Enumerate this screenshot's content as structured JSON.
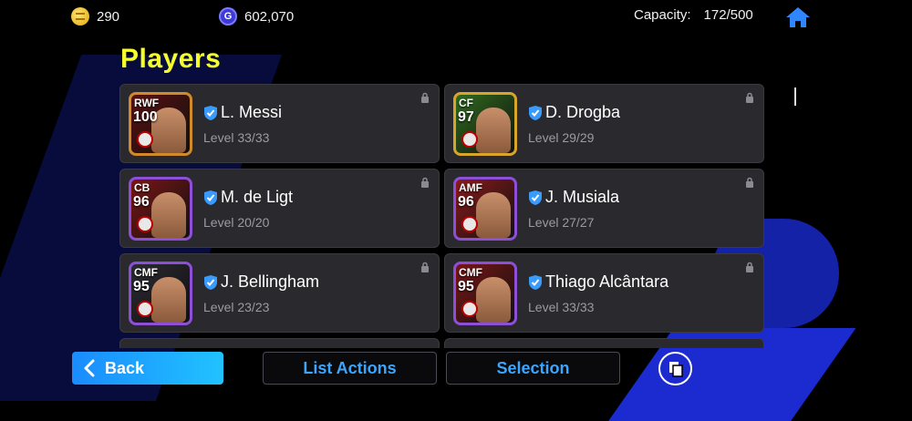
{
  "header": {
    "coins": "290",
    "gp": "602,070",
    "capacity_label": "Capacity:",
    "capacity_value": "172/500"
  },
  "page_title": "Players",
  "players": [
    {
      "position": "RWF",
      "rating": "100",
      "name": "L. Messi",
      "level": "Level 33/33",
      "frame": "#d08a2a",
      "bg": "#5a1010"
    },
    {
      "position": "CF",
      "rating": "97",
      "name": "D. Drogba",
      "level": "Level 29/29",
      "frame": "#d7a52a",
      "bg": "#2f6b1e"
    },
    {
      "position": "CB",
      "rating": "96",
      "name": "M. de Ligt",
      "level": "Level 20/20",
      "frame": "#8c4fd6",
      "bg": "#7a1515"
    },
    {
      "position": "AMF",
      "rating": "96",
      "name": "J. Musiala",
      "level": "Level 27/27",
      "frame": "#8c4fd6",
      "bg": "#8a1a1a"
    },
    {
      "position": "CMF",
      "rating": "95",
      "name": "J. Bellingham",
      "level": "Level 23/23",
      "frame": "#8c4fd6",
      "bg": "#2a2a33"
    },
    {
      "position": "CMF",
      "rating": "95",
      "name": "Thiago Alcântara",
      "level": "Level 33/33",
      "frame": "#8c4fd6",
      "bg": "#7a1515"
    }
  ],
  "bottom": {
    "back_label": "Back",
    "list_actions_label": "List Actions",
    "selection_label": "Selection"
  },
  "icons": {
    "coin": "coin-icon",
    "gp": "gp-icon",
    "home": "home-icon",
    "lock": "lock-icon",
    "verified": "verified-shield-icon",
    "back": "chevron-left-icon",
    "copy": "copy-icon"
  },
  "colors": {
    "title": "#f6ff2a",
    "accent": "#1a8cff",
    "card_bg": "#2a2a2e"
  }
}
